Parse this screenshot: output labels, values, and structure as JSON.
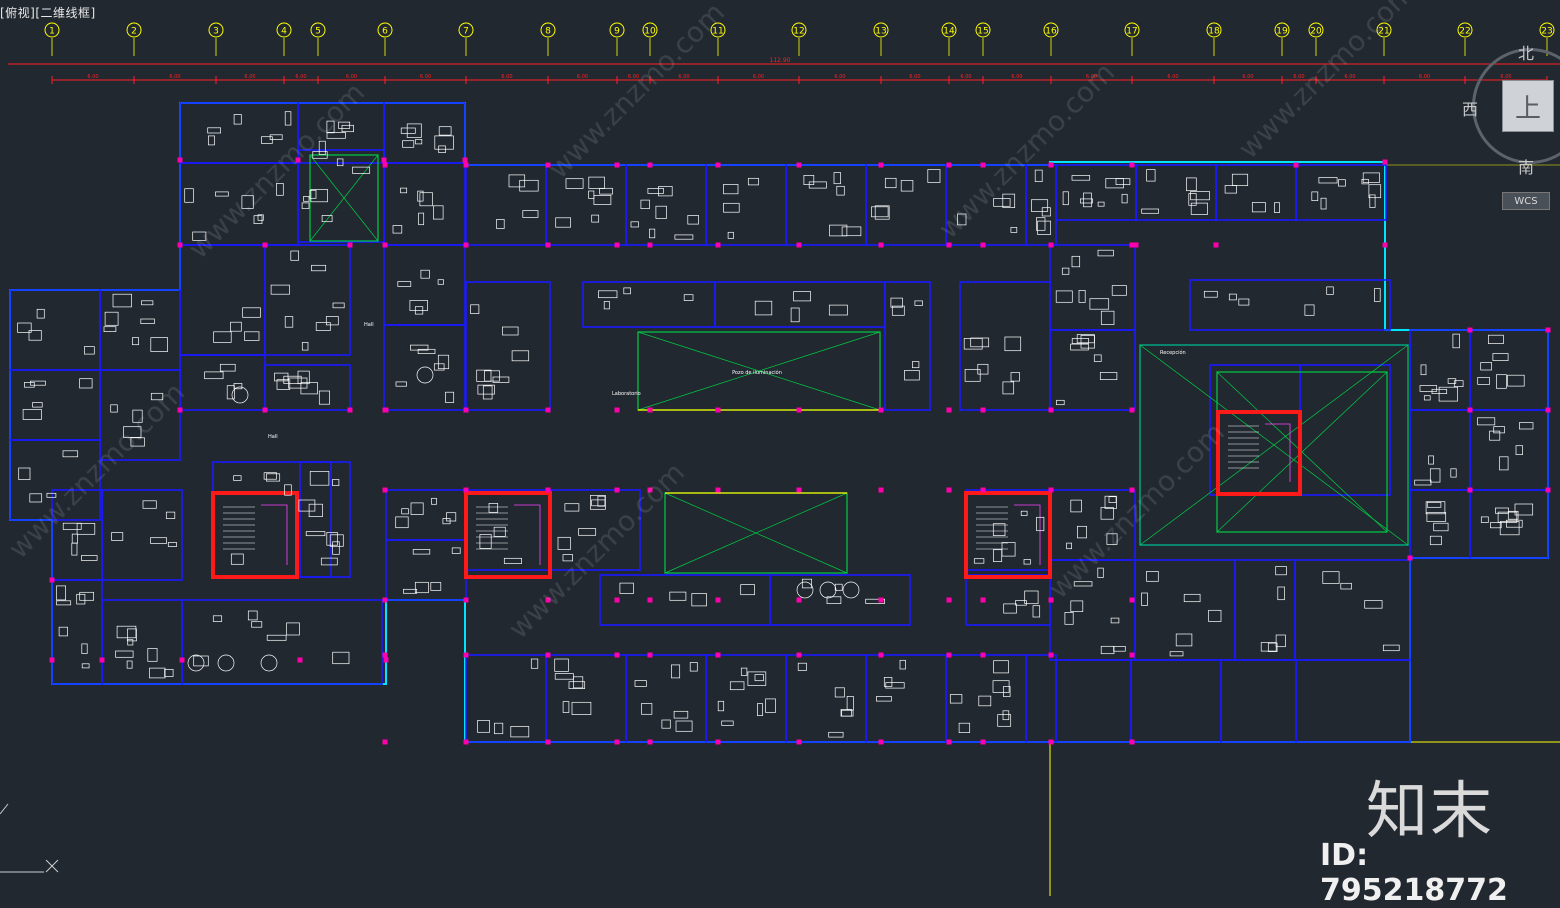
{
  "viewport": {
    "label": "[俯视][二维线框]"
  },
  "grid_axes": {
    "labels": [
      "1",
      "2",
      "3",
      "4",
      "5",
      "6",
      "7",
      "8",
      "9",
      "10",
      "11",
      "12",
      "13",
      "14",
      "15",
      "16",
      "17",
      "18",
      "19",
      "20",
      "21",
      "22",
      "23"
    ],
    "overall_dimension": "112.90",
    "segment_dimension": "6.00"
  },
  "viewcube": {
    "north": "北",
    "south": "南",
    "west": "西",
    "face": "上",
    "wcs_label": "WCS"
  },
  "plan_labels": {
    "central_void": "Pozo de iluminación",
    "reception": "Recepción",
    "hall": "Hall",
    "laboratorio": "Laboratorio"
  },
  "colors": {
    "background": "#212830",
    "walls": "#1a1aff",
    "furniture": "#ffffff",
    "stairs": "#ff1a1a",
    "voids": "#00cc44",
    "grid": "#ffff00",
    "dimension_line": "#ff2020",
    "outline": "#00e5ff",
    "column": "#ff00aa"
  },
  "watermark": {
    "brand": "知末",
    "id": "ID: 795218772",
    "text": "www.znzmo.com"
  }
}
